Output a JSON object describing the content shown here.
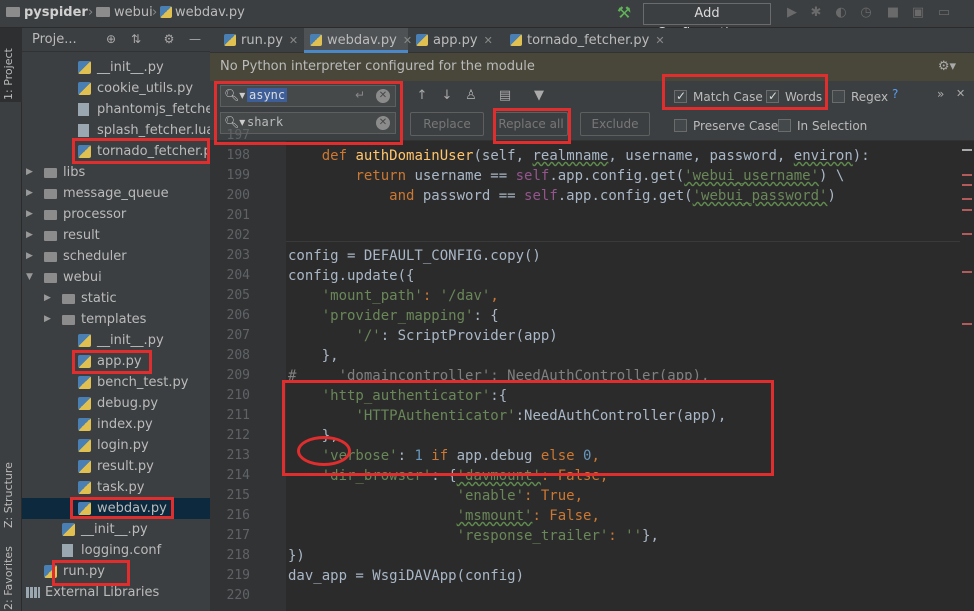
{
  "titlebar": {
    "project": "pyspider",
    "folder": "webui",
    "file": "webdav.py",
    "add_config": "Add Configuration..."
  },
  "side_labels": {
    "project": "1: Project",
    "structure": "Z: Structure",
    "favorites": "2: Favorites"
  },
  "project_panel": {
    "title": "Proje..."
  },
  "tree": [
    {
      "label": "__init__.py",
      "kind": "py"
    },
    {
      "label": "cookie_utils.py",
      "kind": "py"
    },
    {
      "label": "phantomjs_fetcher.j",
      "kind": "file"
    },
    {
      "label": "splash_fetcher.lua",
      "kind": "file"
    },
    {
      "label": "tornado_fetcher.py",
      "kind": "py"
    },
    {
      "label": "libs",
      "kind": "folder"
    },
    {
      "label": "message_queue",
      "kind": "folder"
    },
    {
      "label": "processor",
      "kind": "folder"
    },
    {
      "label": "result",
      "kind": "folder"
    },
    {
      "label": "scheduler",
      "kind": "folder"
    },
    {
      "label": "webui",
      "kind": "folder"
    },
    {
      "label": "static",
      "kind": "folder"
    },
    {
      "label": "templates",
      "kind": "folder"
    },
    {
      "label": "__init__.py",
      "kind": "py"
    },
    {
      "label": "app.py",
      "kind": "py"
    },
    {
      "label": "bench_test.py",
      "kind": "py"
    },
    {
      "label": "debug.py",
      "kind": "py"
    },
    {
      "label": "index.py",
      "kind": "py"
    },
    {
      "label": "login.py",
      "kind": "py"
    },
    {
      "label": "result.py",
      "kind": "py"
    },
    {
      "label": "task.py",
      "kind": "py"
    },
    {
      "label": "webdav.py",
      "kind": "py"
    },
    {
      "label": "__init__.py",
      "kind": "py"
    },
    {
      "label": "logging.conf",
      "kind": "file"
    },
    {
      "label": "run.py",
      "kind": "py"
    },
    {
      "label": "External Libraries",
      "kind": "lib"
    }
  ],
  "tabs": [
    {
      "label": "run.py"
    },
    {
      "label": "webdav.py"
    },
    {
      "label": "app.py"
    },
    {
      "label": "tornado_fetcher.py"
    }
  ],
  "warning": "No Python interpreter configured for the module",
  "find": {
    "search_value": "async",
    "replace_value": "shark",
    "replace_label": "Replace",
    "replace_all_label": "Replace all",
    "exclude_label": "Exclude",
    "match_case": "Match Case",
    "words": "Words",
    "regex": "Regex",
    "regex_help": "?",
    "preserve_case": "Preserve Case",
    "in_selection": "In Selection"
  },
  "code": {
    "line_numbers": [
      "197",
      "198",
      "199",
      "200",
      "201",
      "202",
      "203",
      "204",
      "205",
      "206",
      "207",
      "208",
      "209",
      "210",
      "211",
      "212",
      "213",
      "214",
      "215",
      "216",
      "217",
      "218",
      "219",
      "220"
    ],
    "l198_def": "def",
    "l198_name": "authDomainUser",
    "l198_args": "(self, ",
    "l198_realm": "realmname",
    "l198_rest": ", username, password, ",
    "l198_environ": "environ",
    "l198_end": "):",
    "l199_return": "return",
    "l199_a": " username == ",
    "l199_self": "self",
    "l199_b": ".app.config.get(",
    "l199_str": "'webui_username'",
    "l199_c": ") \\",
    "l200_and": "and",
    "l200_a": " password == ",
    "l200_self": "self",
    "l200_b": ".app.config.get(",
    "l200_str": "'webui_password'",
    "l200_c": ")",
    "l203": "config = DEFAULT_CONFIG.copy()",
    "l204": "config.update({",
    "l205_key": "'mount_path'",
    "l205_val": "'/dav'",
    "l206_key": "'provider_mapping'",
    "l206_rest": ": {",
    "l207_key": "'/'",
    "l207_rest": ": ScriptProvider(app)",
    "l208": "},",
    "l209": "#     'domaincontroller': NeedAuthController(app),",
    "l210_key": "'http_authenticator'",
    "l210_rest": ":{",
    "l211_key": "'HTTPAuthenticator'",
    "l211_rest": ":NeedAuthController(app),",
    "l212": "},",
    "l213_key": "'verbose'",
    "l213_colon": ": ",
    "l213_num1": "1",
    "l213_if": " if ",
    "l213_mid": "app.debug ",
    "l213_else": "else",
    "l213_num0": " 0",
    "l213_end": ",",
    "l214_key": "'dir_browser'",
    "l214_mid": ": {",
    "l214_k2": "'davmount'",
    "l214_v": "False",
    "l215_key": "'enable'",
    "l215_v": "True",
    "l216_key": "'msmount'",
    "l216_v": "False",
    "l217_key": "'response_trailer'",
    "l217_v": "''",
    "l217_end": "},",
    "l218": "})",
    "l219": "dav_app = WsgiDAVApp(config)"
  },
  "colors": {
    "annotation_red": "#e02d2d",
    "keyword": "#cc7832",
    "string": "#6a8759",
    "function": "#ffc66d",
    "number": "#6897bb"
  }
}
